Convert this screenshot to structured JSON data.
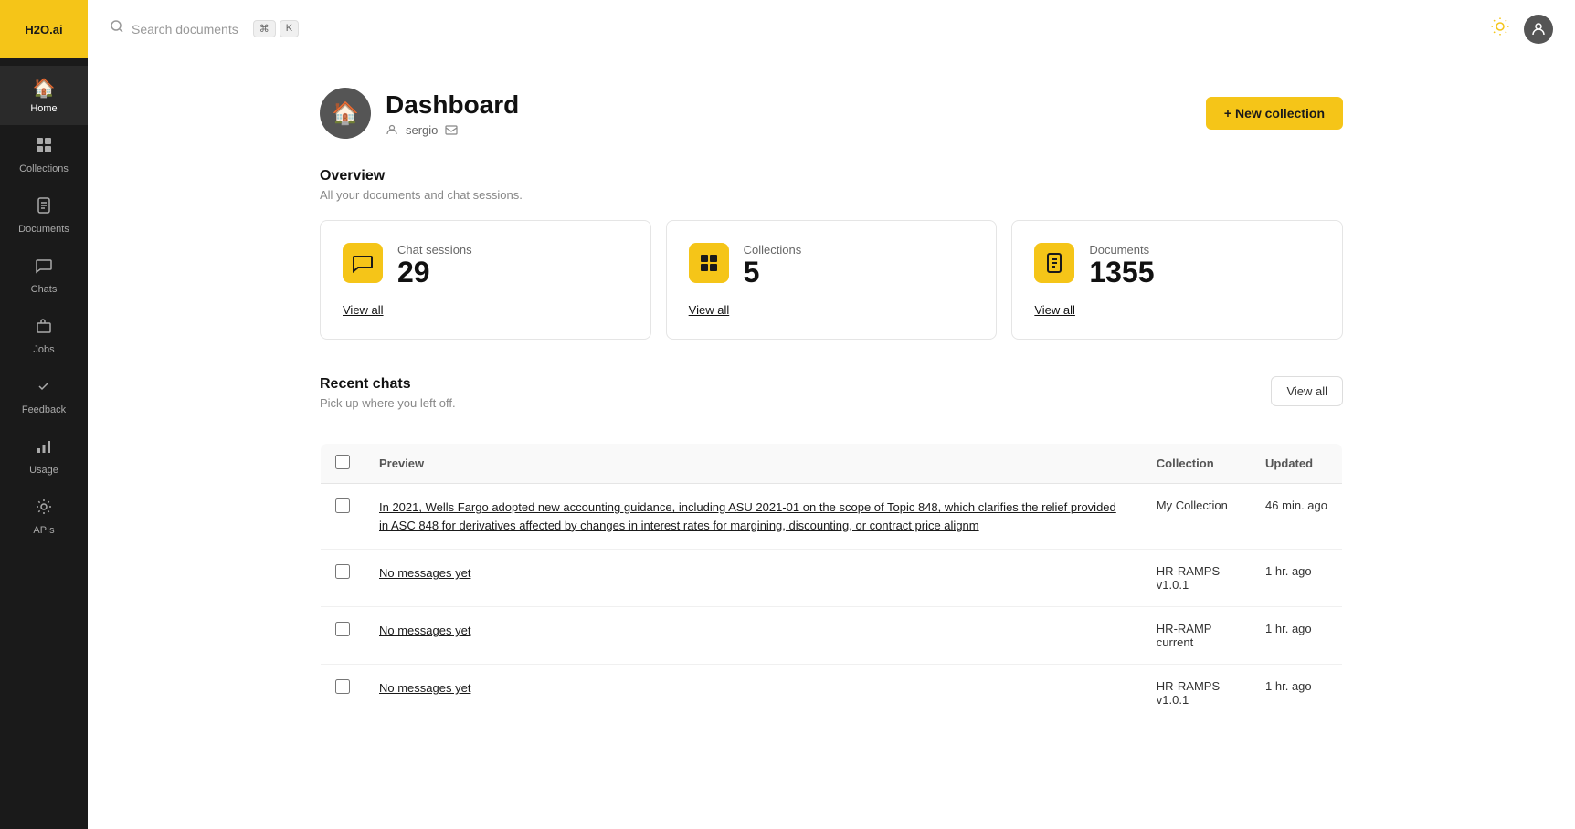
{
  "logo": {
    "text": "H2O.ai"
  },
  "sidebar": {
    "items": [
      {
        "id": "home",
        "label": "Home",
        "icon": "🏠",
        "active": true
      },
      {
        "id": "collections",
        "label": "Collections",
        "icon": "⊞",
        "active": false
      },
      {
        "id": "documents",
        "label": "Documents",
        "icon": "📄",
        "active": false
      },
      {
        "id": "chats",
        "label": "Chats",
        "icon": "💬",
        "active": false
      },
      {
        "id": "jobs",
        "label": "Jobs",
        "icon": "💼",
        "active": false
      },
      {
        "id": "feedback",
        "label": "Feedback",
        "icon": "👍",
        "active": false
      },
      {
        "id": "usage",
        "label": "Usage",
        "icon": "📊",
        "active": false
      },
      {
        "id": "apis",
        "label": "APIs",
        "icon": "⚙️",
        "active": false
      }
    ]
  },
  "topbar": {
    "search_placeholder": "Search documents",
    "kbd1": "⌘",
    "kbd2": "K"
  },
  "dashboard": {
    "title": "Dashboard",
    "user": "sergio",
    "new_collection_label": "+ New collection",
    "overview_title": "Overview",
    "overview_subtitle": "All your documents and chat sessions.",
    "stats": [
      {
        "label": "Chat sessions",
        "value": "29",
        "link": "View all",
        "icon": "💬"
      },
      {
        "label": "Collections",
        "value": "5",
        "link": "View all",
        "icon": "⊞"
      },
      {
        "label": "Documents",
        "value": "1355",
        "link": "View all",
        "icon": "📄"
      }
    ],
    "recent_chats_title": "Recent chats",
    "recent_chats_subtitle": "Pick up where you left off.",
    "view_all_label": "View all",
    "table": {
      "headers": [
        "Preview",
        "Collection",
        "Updated"
      ],
      "rows": [
        {
          "preview": "In 2021, Wells Fargo adopted new accounting guidance, including ASU 2021-01 on the scope of Topic 848, which clarifies the relief provided in ASC 848 for derivatives affected by changes in interest rates for margining, discounting, or contract price alignm",
          "collection": "My Collection",
          "updated": "46 min. ago"
        },
        {
          "preview": "No messages yet",
          "collection": "HR-RAMPS v1.0.1",
          "updated": "1 hr. ago"
        },
        {
          "preview": "No messages yet",
          "collection": "HR-RAMP current",
          "updated": "1 hr. ago"
        },
        {
          "preview": "No messages yet",
          "collection": "HR-RAMPS v1.0.1",
          "updated": "1 hr. ago"
        }
      ]
    }
  }
}
